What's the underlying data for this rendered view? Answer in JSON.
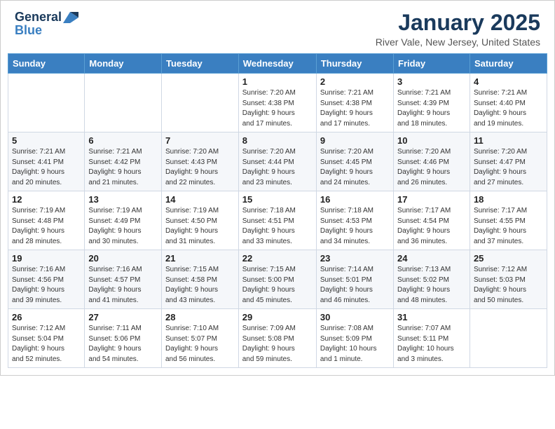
{
  "header": {
    "logo_line1": "General",
    "logo_line2": "Blue",
    "month_title": "January 2025",
    "location": "River Vale, New Jersey, United States"
  },
  "weekdays": [
    "Sunday",
    "Monday",
    "Tuesday",
    "Wednesday",
    "Thursday",
    "Friday",
    "Saturday"
  ],
  "weeks": [
    [
      {
        "day": "",
        "info": ""
      },
      {
        "day": "",
        "info": ""
      },
      {
        "day": "",
        "info": ""
      },
      {
        "day": "1",
        "info": "Sunrise: 7:20 AM\nSunset: 4:38 PM\nDaylight: 9 hours\nand 17 minutes."
      },
      {
        "day": "2",
        "info": "Sunrise: 7:21 AM\nSunset: 4:38 PM\nDaylight: 9 hours\nand 17 minutes."
      },
      {
        "day": "3",
        "info": "Sunrise: 7:21 AM\nSunset: 4:39 PM\nDaylight: 9 hours\nand 18 minutes."
      },
      {
        "day": "4",
        "info": "Sunrise: 7:21 AM\nSunset: 4:40 PM\nDaylight: 9 hours\nand 19 minutes."
      }
    ],
    [
      {
        "day": "5",
        "info": "Sunrise: 7:21 AM\nSunset: 4:41 PM\nDaylight: 9 hours\nand 20 minutes."
      },
      {
        "day": "6",
        "info": "Sunrise: 7:21 AM\nSunset: 4:42 PM\nDaylight: 9 hours\nand 21 minutes."
      },
      {
        "day": "7",
        "info": "Sunrise: 7:20 AM\nSunset: 4:43 PM\nDaylight: 9 hours\nand 22 minutes."
      },
      {
        "day": "8",
        "info": "Sunrise: 7:20 AM\nSunset: 4:44 PM\nDaylight: 9 hours\nand 23 minutes."
      },
      {
        "day": "9",
        "info": "Sunrise: 7:20 AM\nSunset: 4:45 PM\nDaylight: 9 hours\nand 24 minutes."
      },
      {
        "day": "10",
        "info": "Sunrise: 7:20 AM\nSunset: 4:46 PM\nDaylight: 9 hours\nand 26 minutes."
      },
      {
        "day": "11",
        "info": "Sunrise: 7:20 AM\nSunset: 4:47 PM\nDaylight: 9 hours\nand 27 minutes."
      }
    ],
    [
      {
        "day": "12",
        "info": "Sunrise: 7:19 AM\nSunset: 4:48 PM\nDaylight: 9 hours\nand 28 minutes."
      },
      {
        "day": "13",
        "info": "Sunrise: 7:19 AM\nSunset: 4:49 PM\nDaylight: 9 hours\nand 30 minutes."
      },
      {
        "day": "14",
        "info": "Sunrise: 7:19 AM\nSunset: 4:50 PM\nDaylight: 9 hours\nand 31 minutes."
      },
      {
        "day": "15",
        "info": "Sunrise: 7:18 AM\nSunset: 4:51 PM\nDaylight: 9 hours\nand 33 minutes."
      },
      {
        "day": "16",
        "info": "Sunrise: 7:18 AM\nSunset: 4:53 PM\nDaylight: 9 hours\nand 34 minutes."
      },
      {
        "day": "17",
        "info": "Sunrise: 7:17 AM\nSunset: 4:54 PM\nDaylight: 9 hours\nand 36 minutes."
      },
      {
        "day": "18",
        "info": "Sunrise: 7:17 AM\nSunset: 4:55 PM\nDaylight: 9 hours\nand 37 minutes."
      }
    ],
    [
      {
        "day": "19",
        "info": "Sunrise: 7:16 AM\nSunset: 4:56 PM\nDaylight: 9 hours\nand 39 minutes."
      },
      {
        "day": "20",
        "info": "Sunrise: 7:16 AM\nSunset: 4:57 PM\nDaylight: 9 hours\nand 41 minutes."
      },
      {
        "day": "21",
        "info": "Sunrise: 7:15 AM\nSunset: 4:58 PM\nDaylight: 9 hours\nand 43 minutes."
      },
      {
        "day": "22",
        "info": "Sunrise: 7:15 AM\nSunset: 5:00 PM\nDaylight: 9 hours\nand 45 minutes."
      },
      {
        "day": "23",
        "info": "Sunrise: 7:14 AM\nSunset: 5:01 PM\nDaylight: 9 hours\nand 46 minutes."
      },
      {
        "day": "24",
        "info": "Sunrise: 7:13 AM\nSunset: 5:02 PM\nDaylight: 9 hours\nand 48 minutes."
      },
      {
        "day": "25",
        "info": "Sunrise: 7:12 AM\nSunset: 5:03 PM\nDaylight: 9 hours\nand 50 minutes."
      }
    ],
    [
      {
        "day": "26",
        "info": "Sunrise: 7:12 AM\nSunset: 5:04 PM\nDaylight: 9 hours\nand 52 minutes."
      },
      {
        "day": "27",
        "info": "Sunrise: 7:11 AM\nSunset: 5:06 PM\nDaylight: 9 hours\nand 54 minutes."
      },
      {
        "day": "28",
        "info": "Sunrise: 7:10 AM\nSunset: 5:07 PM\nDaylight: 9 hours\nand 56 minutes."
      },
      {
        "day": "29",
        "info": "Sunrise: 7:09 AM\nSunset: 5:08 PM\nDaylight: 9 hours\nand 59 minutes."
      },
      {
        "day": "30",
        "info": "Sunrise: 7:08 AM\nSunset: 5:09 PM\nDaylight: 10 hours\nand 1 minute."
      },
      {
        "day": "31",
        "info": "Sunrise: 7:07 AM\nSunset: 5:11 PM\nDaylight: 10 hours\nand 3 minutes."
      },
      {
        "day": "",
        "info": ""
      }
    ]
  ]
}
